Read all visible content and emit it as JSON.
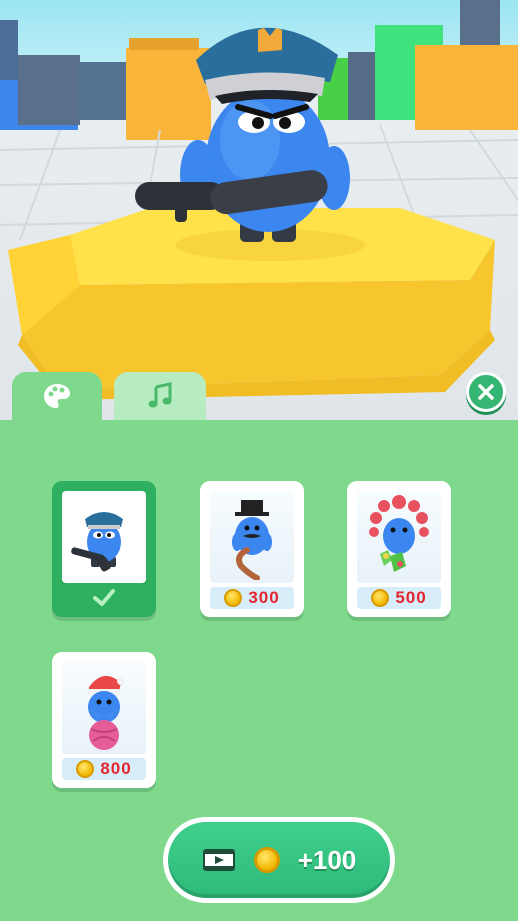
{
  "tabs": [
    {
      "id": "skins",
      "icon": "palette-icon",
      "selected": true
    },
    {
      "id": "music",
      "icon": "music-note-icon",
      "selected": false
    }
  ],
  "close_icon": "close-icon",
  "skins": [
    {
      "name_icon": "police-skin",
      "selected": true,
      "price": null
    },
    {
      "name_icon": "gentleman-skin",
      "selected": false,
      "price": "300"
    },
    {
      "name_icon": "bubble-skin",
      "selected": false,
      "price": "500"
    },
    {
      "name_icon": "santa-skin",
      "selected": false,
      "price": "800"
    }
  ],
  "reward_button": {
    "amount": "+100",
    "icon_video": "video-ad-icon",
    "icon_coin": "coin-icon"
  },
  "colors": {
    "panel_green": "#7ed98d",
    "selected_green": "#2fb060",
    "price_red": "#e3262f",
    "button_green": "#35b673"
  }
}
